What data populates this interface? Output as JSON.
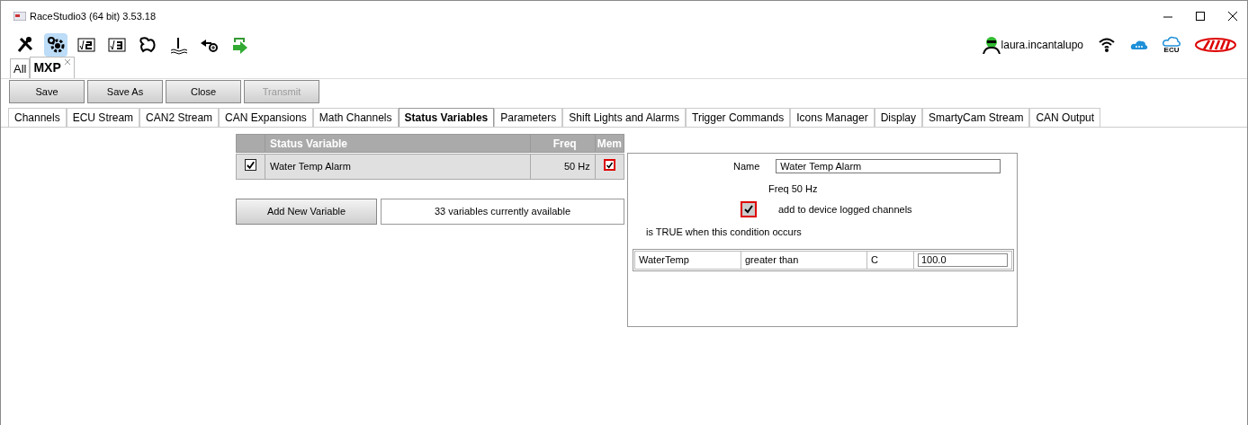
{
  "window": {
    "title": "RaceStudio3 (64 bit) 3.53.18"
  },
  "toolbar": [
    {
      "kind": "wrench",
      "selected": false
    },
    {
      "kind": "gear",
      "selected": true
    },
    {
      "kind": "v2",
      "selected": false
    },
    {
      "kind": "v3",
      "selected": false
    },
    {
      "kind": "track",
      "selected": false
    },
    {
      "kind": "water",
      "selected": false
    },
    {
      "kind": "import",
      "selected": false
    },
    {
      "kind": "transfer",
      "selected": false
    }
  ],
  "user": {
    "name": "laura.incantalupo"
  },
  "ecu_label": "ECU",
  "doc_tabs": [
    {
      "label": "All",
      "selected": false,
      "closable": false
    },
    {
      "label": "MXP",
      "selected": true,
      "closable": true
    }
  ],
  "buttons": [
    {
      "label": "Save",
      "disabled": false
    },
    {
      "label": "Save As",
      "disabled": false
    },
    {
      "label": "Close",
      "disabled": false
    },
    {
      "label": "Transmit",
      "disabled": true
    }
  ],
  "tabs": [
    {
      "label": "Channels",
      "selected": false
    },
    {
      "label": "ECU Stream",
      "selected": false
    },
    {
      "label": "CAN2 Stream",
      "selected": false
    },
    {
      "label": "CAN Expansions",
      "selected": false
    },
    {
      "label": "Math Channels",
      "selected": false
    },
    {
      "label": "Status Variables",
      "selected": true
    },
    {
      "label": "Parameters",
      "selected": false
    },
    {
      "label": "Shift Lights and Alarms",
      "selected": false
    },
    {
      "label": "Trigger Commands",
      "selected": false
    },
    {
      "label": "Icons Manager",
      "selected": false
    },
    {
      "label": "Display",
      "selected": false
    },
    {
      "label": "SmartyCam Stream",
      "selected": false
    },
    {
      "label": "CAN Output",
      "selected": false
    }
  ],
  "table": {
    "columns": [
      "Status Variable",
      "Freq",
      "Mem"
    ],
    "rows": [
      {
        "enabled": true,
        "name": "Water Temp Alarm",
        "freq": "50 Hz",
        "mem": true
      }
    ]
  },
  "add_button": "Add New Variable",
  "available": "33 variables currently available",
  "detail": {
    "name_label": "Name",
    "name_value": "Water Temp Alarm",
    "freq": "Freq 50 Hz",
    "logged": {
      "label": "add to device logged channels",
      "checked": true
    },
    "condition_text": "is TRUE when this condition occurs",
    "condition": {
      "channel": "WaterTemp",
      "operator": "greater than",
      "unit": "C",
      "value": "100.0"
    }
  }
}
